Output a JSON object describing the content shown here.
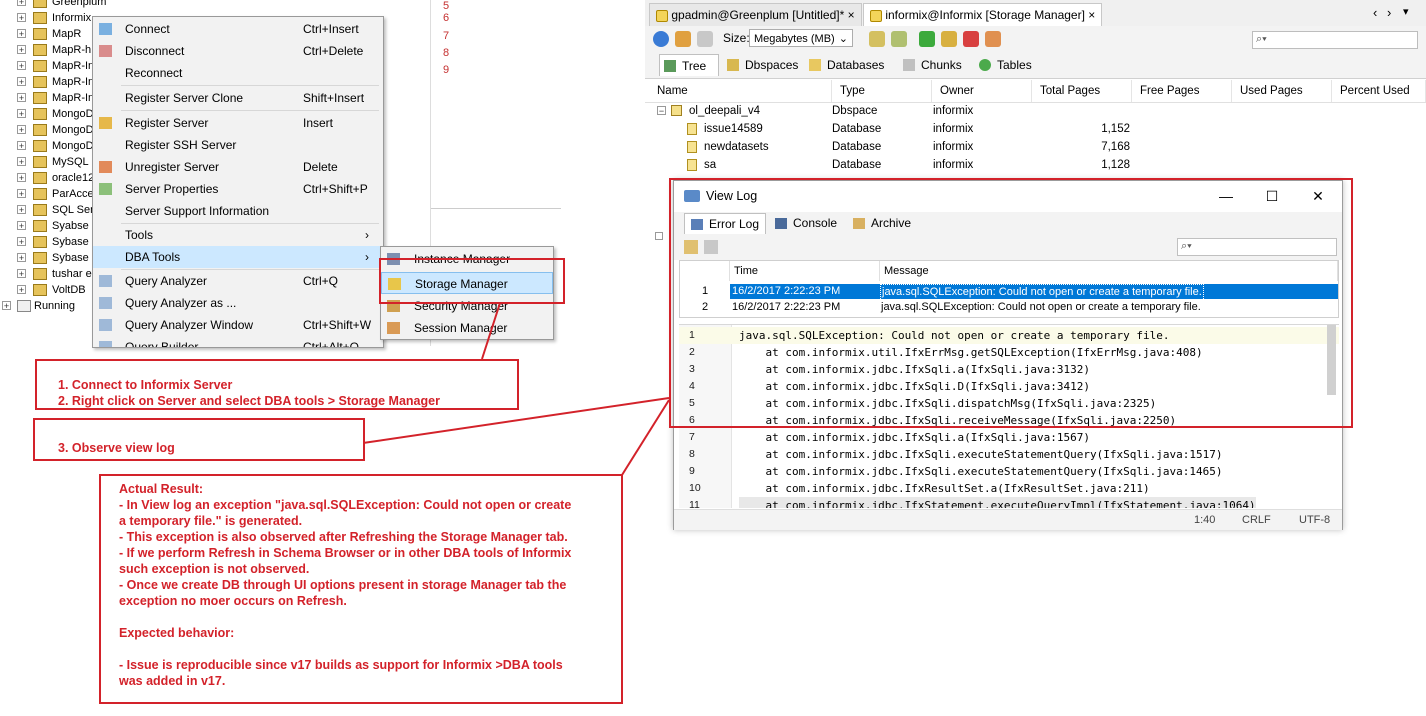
{
  "left_tree": {
    "items": [
      "Greenplum",
      "Informix",
      "MapR",
      "MapR-h",
      "MapR-In",
      "MapR-In",
      "MapR-In",
      "MongoD",
      "MongoD",
      "MongoD",
      "MySQL",
      "oracle12",
      "ParAcce",
      "SQL Ser",
      "Syabse",
      "Sybase",
      "Sybase",
      "tushar e",
      "VoltDB"
    ],
    "running": "Running"
  },
  "context_menu": {
    "items": [
      {
        "label": "Connect",
        "shortcut": "Ctrl+Insert"
      },
      {
        "label": "Disconnect",
        "shortcut": "Ctrl+Delete"
      },
      {
        "label": "Reconnect",
        "shortcut": ""
      },
      {
        "label": "Register Server Clone",
        "shortcut": "Shift+Insert"
      },
      {
        "label": "Register Server",
        "shortcut": "Insert"
      },
      {
        "label": "Register SSH Server",
        "shortcut": ""
      },
      {
        "label": "Unregister Server",
        "shortcut": "Delete"
      },
      {
        "label": "Server Properties",
        "shortcut": "Ctrl+Shift+P"
      },
      {
        "label": "Server Support Information",
        "shortcut": ""
      },
      {
        "label": "Tools",
        "shortcut": "›"
      },
      {
        "label": "DBA Tools",
        "shortcut": "›"
      },
      {
        "label": "Query Analyzer",
        "shortcut": "Ctrl+Q"
      },
      {
        "label": "Query Analyzer as ...",
        "shortcut": ""
      },
      {
        "label": "Query Analyzer Window",
        "shortcut": "Ctrl+Shift+W"
      },
      {
        "label": "Query Builder",
        "shortcut": "Ctrl+Alt+Q"
      }
    ]
  },
  "dba_submenu": {
    "items": [
      "Instance Manager",
      "Storage Manager",
      "Security Manager",
      "Session Manager"
    ]
  },
  "editor": {
    "line_numbers": [
      "5",
      "6",
      "7",
      "8",
      "9"
    ]
  },
  "tabs": {
    "items": [
      "gpadmin@Greenplum [Untitled]*",
      "informix@Informix [Storage Manager]"
    ],
    "close": "×",
    "nav_prev": "‹",
    "nav_next": "›",
    "menu": "▾"
  },
  "toolbar": {
    "size_label": "Size:",
    "size_value": "Megabytes (MB)"
  },
  "storage_tabs": [
    "Tree",
    "Dbspaces",
    "Databases",
    "Chunks",
    "Tables"
  ],
  "grid": {
    "headers": [
      "Name",
      "Type",
      "Owner",
      "Total Pages",
      "Free Pages",
      "Used Pages",
      "Percent Used"
    ],
    "rows": [
      {
        "name": "ol_deepali_v4",
        "type": "Dbspace",
        "owner": "informix",
        "total": ""
      },
      {
        "name": "issue14589",
        "type": "Database",
        "owner": "informix",
        "total": "1,152"
      },
      {
        "name": "newdatasets",
        "type": "Database",
        "owner": "informix",
        "total": "7,168"
      },
      {
        "name": "sa",
        "type": "Database",
        "owner": "informix",
        "total": "1,128"
      }
    ]
  },
  "view_log": {
    "title": "View Log",
    "win_min": "—",
    "win_max": "☐",
    "win_close": "✕",
    "tabs": [
      "Error Log",
      "Console",
      "Archive"
    ],
    "headers": [
      "Time",
      "Message"
    ],
    "rows": [
      {
        "no": "1",
        "time": "16/2/2017 2:22:23 PM",
        "message": "java.sql.SQLException: Could not open or create a temporary file."
      },
      {
        "no": "2",
        "time": "16/2/2017 2:22:23 PM",
        "message": "java.sql.SQLException: Could not open or create a temporary file."
      }
    ],
    "code_lines": [
      "java.sql.SQLException: Could not open or create a temporary file.",
      "    at com.informix.util.IfxErrMsg.getSQLException(IfxErrMsg.java:408)",
      "    at com.informix.jdbc.IfxSqli.a(IfxSqli.java:3132)",
      "    at com.informix.jdbc.IfxSqli.D(IfxSqli.java:3412)",
      "    at com.informix.jdbc.IfxSqli.dispatchMsg(IfxSqli.java:2325)",
      "    at com.informix.jdbc.IfxSqli.receiveMessage(IfxSqli.java:2250)",
      "    at com.informix.jdbc.IfxSqli.a(IfxSqli.java:1567)",
      "    at com.informix.jdbc.IfxSqli.executeStatementQuery(IfxSqli.java:1517)",
      "    at com.informix.jdbc.IfxSqli.executeStatementQuery(IfxSqli.java:1465)",
      "    at com.informix.jdbc.IfxResultSet.a(IfxResultSet.java:211)",
      "    at com.informix.jdbc.IfxStatement.executeQueryImpl(IfxStatement.java:1064)"
    ],
    "status": {
      "position": "1:40",
      "line_ending": "CRLF",
      "encoding": "UTF-8"
    }
  },
  "annotations": {
    "steps_1_2": [
      "1. Connect to Informix Server",
      "2. Right click on Server and select  DBA tools >   Storage Manager"
    ],
    "step_3": "3. Observe view log",
    "result_lines": [
      "Actual Result:",
      "- In View log an exception \"java.sql.SQLException: Could not open or create",
      "a temporary file.\" is generated.",
      "- This exception is also observed after Refreshing the Storage Manager tab.",
      "- If we perform Refresh in Schema Browser or in other DBA tools of Informix",
      "such exception is not observed.",
      "- Once we create DB through UI options present in storage Manager tab the",
      "exception no moer occurs on Refresh.",
      "",
      "Expected behavior:",
      "",
      "- Issue is reproducible since v17 builds as support for Informix >DBA tools",
      "was added in v17."
    ]
  },
  "colors": {
    "accent_red": "#d3222a",
    "selection_blue": "#0078d7",
    "menu_highlight": "#cce8ff"
  }
}
